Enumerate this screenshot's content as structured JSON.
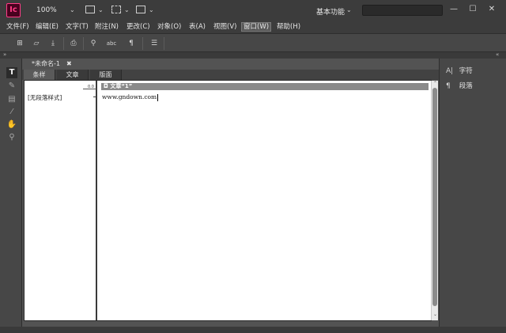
{
  "app": {
    "logo_text": "Ic",
    "zoom": "100%",
    "workspace": "基本功能",
    "search_placeholder": "",
    "window_buttons": {
      "minimize": "—",
      "maximize": "☐",
      "close": "✕"
    }
  },
  "menu": {
    "items": [
      "文件(F)",
      "编辑(E)",
      "文字(T)",
      "附注(N)",
      "更改(C)",
      "对象(O)",
      "表(A)",
      "视图(V)",
      "窗口(W)",
      "帮助(H)"
    ],
    "active": "窗口(W)"
  },
  "toolbar": {
    "icons": [
      "new-icon",
      "open-icon",
      "download-icon",
      "print-icon",
      "search-icon",
      "spellcheck-icon",
      "pilcrow-icon",
      "menu-icon"
    ]
  },
  "document": {
    "tab_title": "*未命名-1",
    "tab_close": "✖",
    "view_tabs": [
      "条样",
      "文章",
      "版面"
    ],
    "active_view": "条样",
    "ruler_value": "0.0",
    "paragraph_style": "[无段落样式]",
    "story_header": "文章“1”",
    "story_text": "www.gndown.com"
  },
  "right_panel": {
    "items": [
      {
        "icon": "character-icon",
        "label": "字符"
      },
      {
        "icon": "paragraph-icon",
        "label": "段落"
      }
    ]
  },
  "left_tools": [
    "type-tool-icon",
    "note-tool-icon",
    "notes-panel-icon",
    "eyedropper-icon",
    "hand-icon",
    "zoom-icon"
  ]
}
